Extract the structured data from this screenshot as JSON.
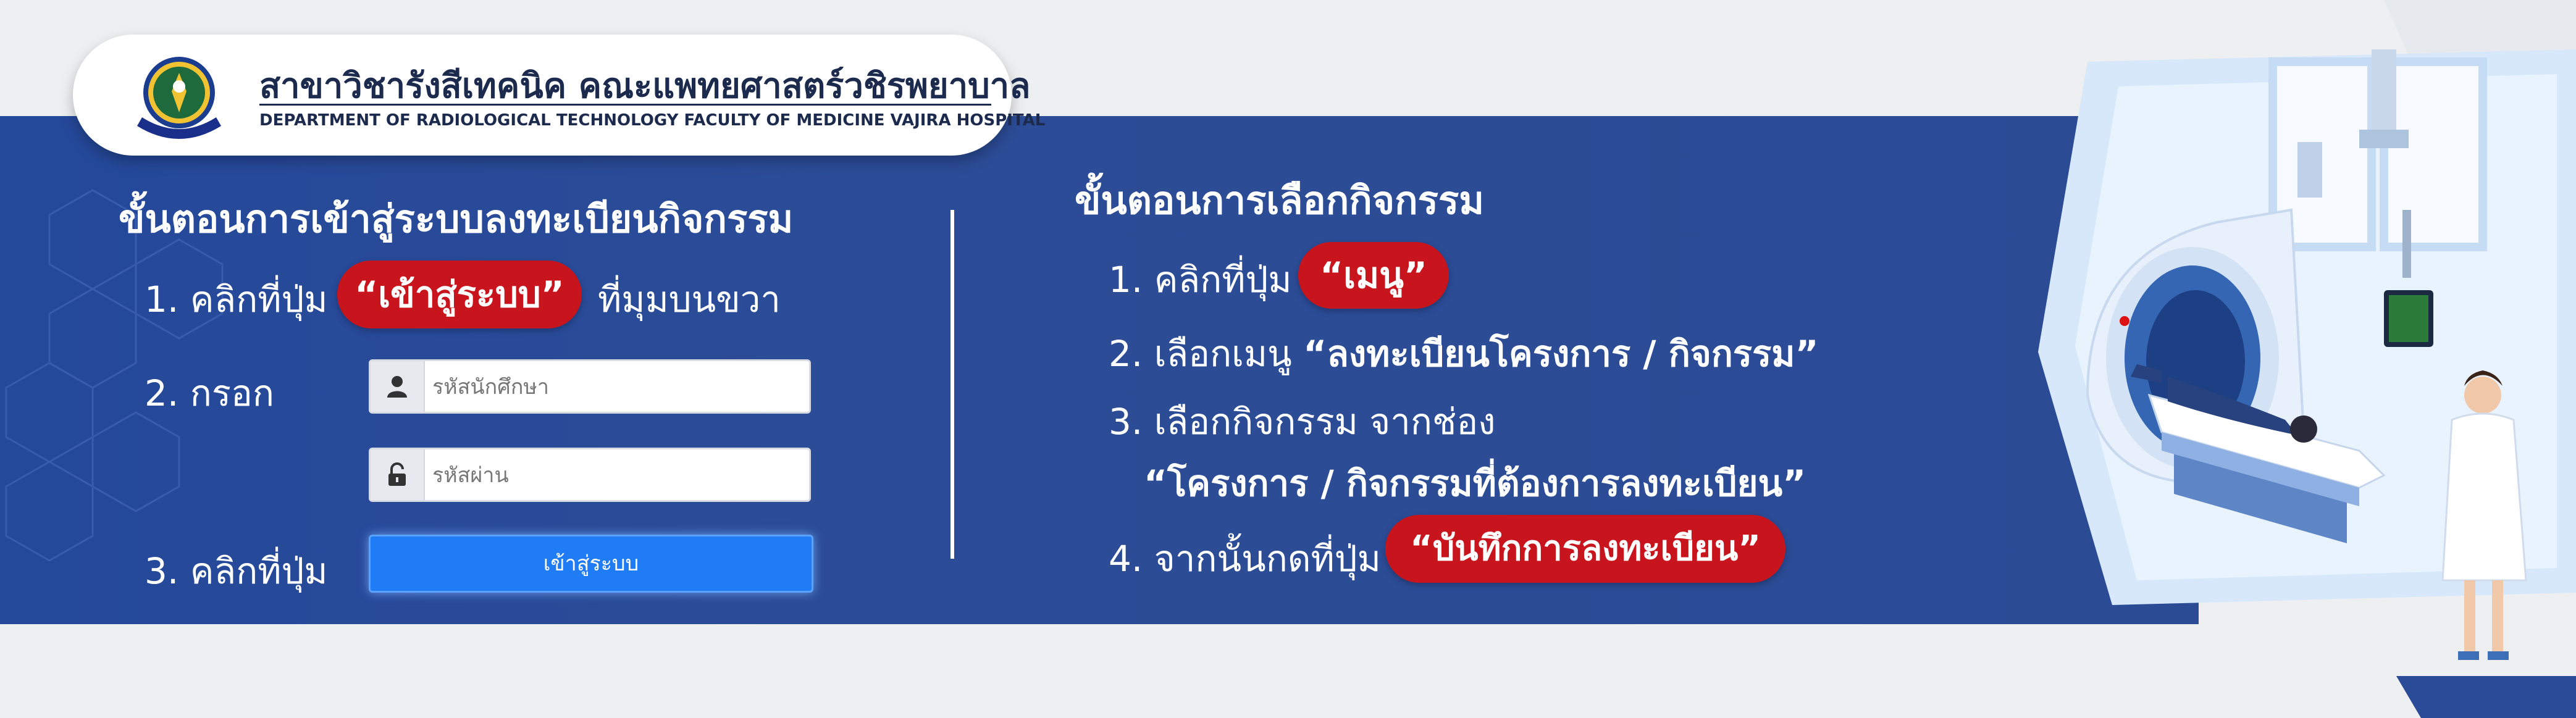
{
  "header": {
    "dept_th": "สาขาวิชารังสีเทคนิค คณะแพทยศาสตร์วชิรพยาบาล",
    "dept_en": "DEPARTMENT OF RADIOLOGICAL TECHNOLOGY FACULTY OF MEDICINE VAJIRA HOSPITAL"
  },
  "login_section": {
    "title": "ขั้นตอนการเข้าสู่ระบบลงทะเบียนกิจกรรม",
    "step1_prefix": "1. คลิกที่ปุ่ม",
    "step1_button": "“เข้าสู่ระบบ”",
    "step1_suffix": "ที่มุมบนขวา",
    "step2_label": "2. กรอก",
    "student_id_placeholder": "รหัสนักศึกษา",
    "password_placeholder": "รหัสผ่าน",
    "step3_label": "3. คลิกที่ปุ่ม",
    "login_button": "เข้าสู่ระบบ"
  },
  "activity_section": {
    "title": "ขั้นตอนการเลือกกิจกรรม",
    "step1_prefix": "1. คลิกที่ปุ่ม",
    "step1_button": "“เมนู”",
    "step2_prefix": "2. เลือกเมนู",
    "step2_bold": "“ลงทะเบียนโครงการ / กิจกรรม”",
    "step3_line1": "3. เลือกกิจกรรม จากช่อง",
    "step3_line2": "“โครงการ / กิจกรรมที่ต้องการลงทะเบียน”",
    "step4_prefix": "4. จากนั้นกดที่ปุ่ม",
    "step4_button": "“บันทึกการลงทะเบียน”"
  },
  "icons": {
    "seal": "university-seal-icon",
    "user": "user-icon",
    "lock": "unlock-icon",
    "illustration": "ct-scanner-illustration"
  },
  "colors": {
    "banner": "#2a4b97",
    "accent_red": "#c8151d",
    "login_button": "#1f7cf4"
  }
}
